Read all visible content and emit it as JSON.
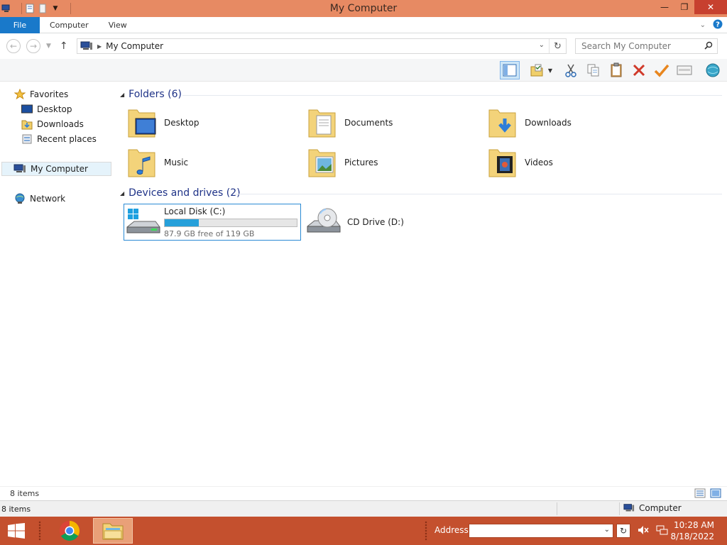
{
  "window": {
    "title": "My Computer"
  },
  "ribbon": {
    "tabs": [
      "File",
      "Computer",
      "View"
    ]
  },
  "nav": {
    "address": "My Computer",
    "search_placeholder": "Search My Computer"
  },
  "sidebar": {
    "favorites_label": "Favorites",
    "favorites": [
      "Desktop",
      "Downloads",
      "Recent places"
    ],
    "my_computer": "My Computer",
    "network": "Network"
  },
  "content": {
    "folders_header": "Folders (6)",
    "folders": [
      {
        "label": "Desktop",
        "icon": "folder-desktop-icon"
      },
      {
        "label": "Documents",
        "icon": "folder-documents-icon"
      },
      {
        "label": "Downloads",
        "icon": "folder-downloads-icon"
      },
      {
        "label": "Music",
        "icon": "folder-music-icon"
      },
      {
        "label": "Pictures",
        "icon": "folder-pictures-icon"
      },
      {
        "label": "Videos",
        "icon": "folder-videos-icon"
      }
    ],
    "drives_header": "Devices and drives (2)",
    "drives": [
      {
        "label": "Local Disk (C:)",
        "free_text": "87.9 GB free of 119 GB",
        "used_fraction": 0.26
      },
      {
        "label": "CD Drive (D:)"
      }
    ]
  },
  "status": {
    "items_count": "8 items",
    "bottom_items": "8 items",
    "zone": "Computer"
  },
  "taskbar": {
    "address_label": "Address",
    "time": "10:28 AM",
    "date": "8/18/2022"
  },
  "colors": {
    "titlebar": "#e78a63",
    "accent": "#1979ca",
    "taskbar": "#c4502e",
    "progress": "#26a0da",
    "header_text": "#1e3287"
  }
}
